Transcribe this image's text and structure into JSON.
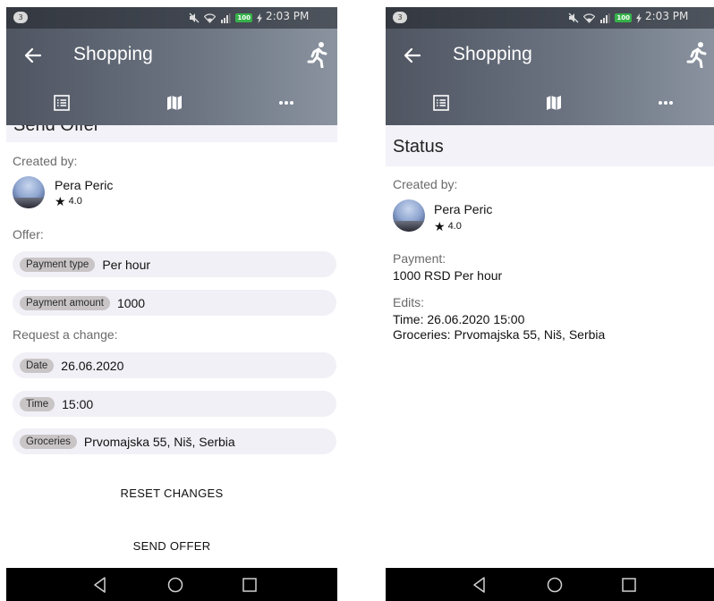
{
  "status_bar": {
    "notification_count": "3",
    "battery": "100",
    "time": "2:03 PM"
  },
  "app_bar": {
    "title": "Shopping",
    "back_icon": "arrow-left-icon",
    "action_icon": "running-person-icon"
  },
  "tabs": [
    {
      "icon": "list-icon"
    },
    {
      "icon": "map-icon"
    },
    {
      "icon": "more-horizontal-icon"
    }
  ],
  "left_screen": {
    "section_title": "Send Offer",
    "created_by_label": "Created by:",
    "user": {
      "name": "Pera Peric",
      "rating": "4.0"
    },
    "offer_label": "Offer:",
    "offer_fields": [
      {
        "chip": "Payment type",
        "value": "Per hour"
      },
      {
        "chip": "Payment amount",
        "value": "1000"
      }
    ],
    "request_label": "Request a change:",
    "request_fields": [
      {
        "chip": "Date",
        "value": "26.06.2020"
      },
      {
        "chip": "Time",
        "value": "15:00"
      },
      {
        "chip": "Groceries",
        "value": "Prvomajska 55, Niš, Serbia"
      }
    ],
    "reset_button": "RESET CHANGES",
    "send_button": "SEND OFFER"
  },
  "right_screen": {
    "section_title": "Status",
    "created_by_label": "Created by:",
    "user": {
      "name": "Pera Peric",
      "rating": "4.0"
    },
    "payment_label": "Payment:",
    "payment_value": "1000 RSD Per hour",
    "edits_label": "Edits:",
    "edits": [
      "Time: 26.06.2020 15:00",
      "Groceries: Prvomajska 55, Niš, Serbia"
    ]
  },
  "nav_bar": {
    "back": "triangle-back-icon",
    "home": "circle-home-icon",
    "recent": "square-recent-icon"
  }
}
